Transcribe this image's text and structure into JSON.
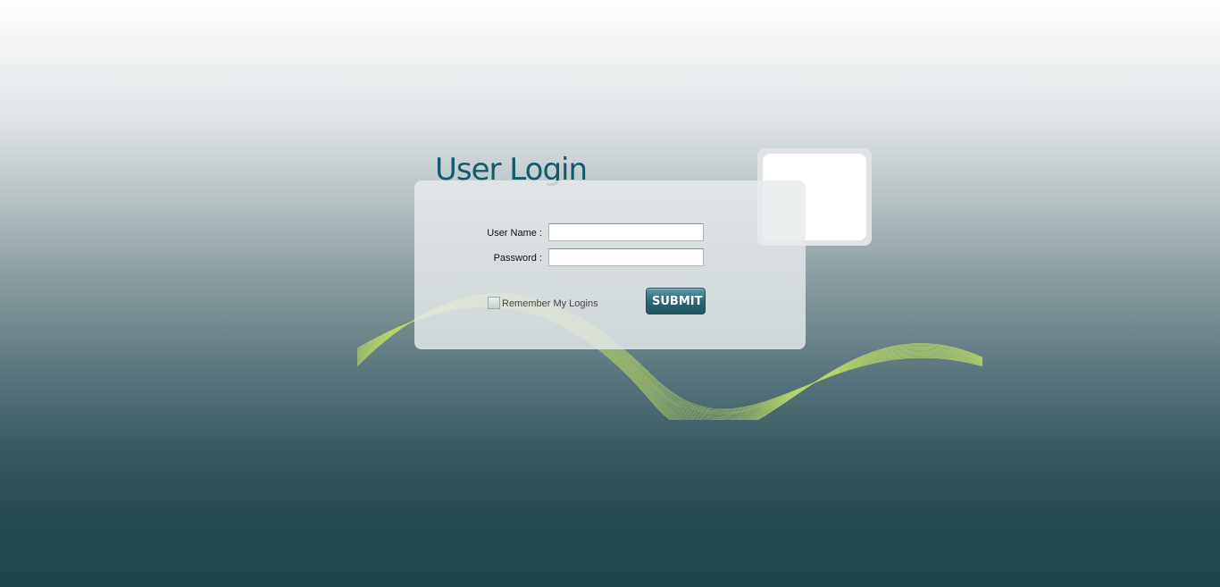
{
  "login": {
    "title": "User Login",
    "username_label": "User Name :",
    "username_value": "",
    "password_label": "Password :",
    "password_value": "",
    "remember_label": "Remember My Logins",
    "remember_checked": false,
    "submit_label": "SUBMIT"
  },
  "colors": {
    "accent": "#135a6a",
    "button": "#2c6673",
    "wave": "#d8ec7a"
  }
}
